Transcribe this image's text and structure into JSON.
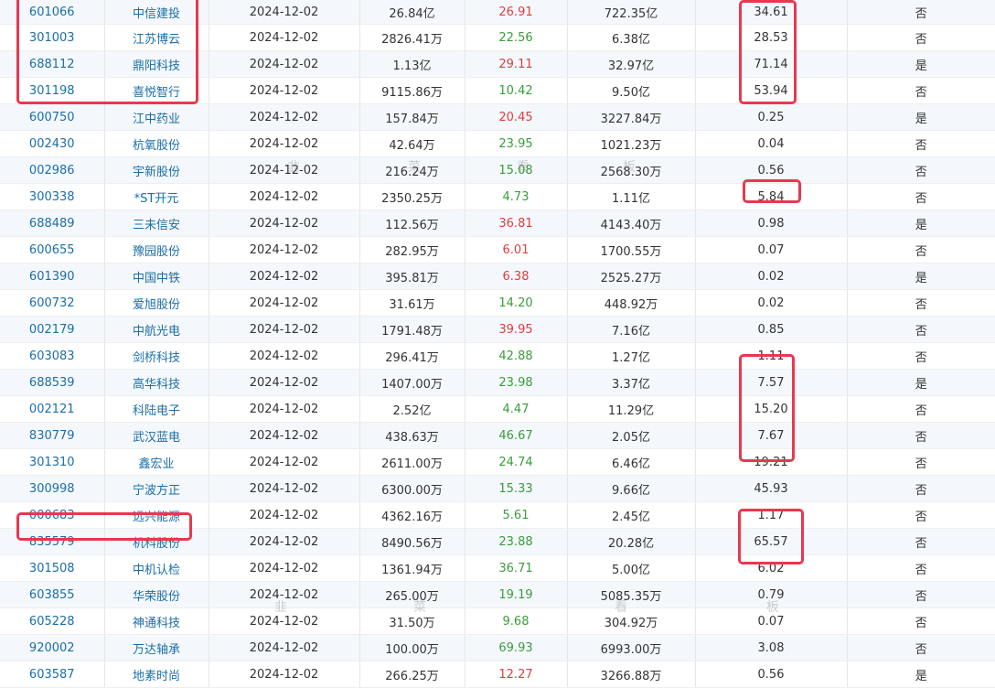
{
  "rows": [
    {
      "code": "601066",
      "name": "中信建投",
      "date": "2024-12-02",
      "turnover": "26.84亿",
      "pct": "26.91",
      "trend": "up",
      "cap": "722.35亿",
      "ratio": "34.61",
      "flag": "否"
    },
    {
      "code": "301003",
      "name": "江苏博云",
      "date": "2024-12-02",
      "turnover": "2826.41万",
      "pct": "22.56",
      "trend": "down",
      "cap": "6.38亿",
      "ratio": "28.53",
      "flag": "否"
    },
    {
      "code": "688112",
      "name": "鼎阳科技",
      "date": "2024-12-02",
      "turnover": "1.13亿",
      "pct": "29.11",
      "trend": "up",
      "cap": "32.97亿",
      "ratio": "71.14",
      "flag": "是"
    },
    {
      "code": "301198",
      "name": "喜悦智行",
      "date": "2024-12-02",
      "turnover": "9115.86万",
      "pct": "10.42",
      "trend": "down",
      "cap": "9.50亿",
      "ratio": "53.94",
      "flag": "否"
    },
    {
      "code": "600750",
      "name": "江中药业",
      "date": "2024-12-02",
      "turnover": "157.84万",
      "pct": "20.45",
      "trend": "up",
      "cap": "3227.84万",
      "ratio": "0.25",
      "flag": "是"
    },
    {
      "code": "002430",
      "name": "杭氧股份",
      "date": "2024-12-02",
      "turnover": "42.64万",
      "pct": "23.95",
      "trend": "down",
      "cap": "1021.23万",
      "ratio": "0.04",
      "flag": "否"
    },
    {
      "code": "002986",
      "name": "宇新股份",
      "date": "2024-12-02",
      "turnover": "216.24万",
      "pct": "15.08",
      "trend": "down",
      "cap": "2568.30万",
      "ratio": "0.56",
      "flag": "否"
    },
    {
      "code": "300338",
      "name": "*ST开元",
      "date": "2024-12-02",
      "turnover": "2350.25万",
      "pct": "4.73",
      "trend": "down",
      "cap": "1.11亿",
      "ratio": "5.84",
      "flag": "否"
    },
    {
      "code": "688489",
      "name": "三未信安",
      "date": "2024-12-02",
      "turnover": "112.56万",
      "pct": "36.81",
      "trend": "up",
      "cap": "4143.40万",
      "ratio": "0.98",
      "flag": "是"
    },
    {
      "code": "600655",
      "name": "豫园股份",
      "date": "2024-12-02",
      "turnover": "282.95万",
      "pct": "6.01",
      "trend": "up",
      "cap": "1700.55万",
      "ratio": "0.07",
      "flag": "否"
    },
    {
      "code": "601390",
      "name": "中国中铁",
      "date": "2024-12-02",
      "turnover": "395.81万",
      "pct": "6.38",
      "trend": "up",
      "cap": "2525.27万",
      "ratio": "0.02",
      "flag": "是"
    },
    {
      "code": "600732",
      "name": "爱旭股份",
      "date": "2024-12-02",
      "turnover": "31.61万",
      "pct": "14.20",
      "trend": "down",
      "cap": "448.92万",
      "ratio": "0.02",
      "flag": "否"
    },
    {
      "code": "002179",
      "name": "中航光电",
      "date": "2024-12-02",
      "turnover": "1791.48万",
      "pct": "39.95",
      "trend": "up",
      "cap": "7.16亿",
      "ratio": "0.85",
      "flag": "否"
    },
    {
      "code": "603083",
      "name": "剑桥科技",
      "date": "2024-12-02",
      "turnover": "296.41万",
      "pct": "42.88",
      "trend": "down",
      "cap": "1.27亿",
      "ratio": "1.11",
      "flag": "否"
    },
    {
      "code": "688539",
      "name": "高华科技",
      "date": "2024-12-02",
      "turnover": "1407.00万",
      "pct": "23.98",
      "trend": "down",
      "cap": "3.37亿",
      "ratio": "7.57",
      "flag": "是"
    },
    {
      "code": "002121",
      "name": "科陆电子",
      "date": "2024-12-02",
      "turnover": "2.52亿",
      "pct": "4.47",
      "trend": "down",
      "cap": "11.29亿",
      "ratio": "15.20",
      "flag": "否"
    },
    {
      "code": "830779",
      "name": "武汉蓝电",
      "date": "2024-12-02",
      "turnover": "438.63万",
      "pct": "46.67",
      "trend": "down",
      "cap": "2.05亿",
      "ratio": "7.67",
      "flag": "否"
    },
    {
      "code": "301310",
      "name": "鑫宏业",
      "date": "2024-12-02",
      "turnover": "2611.00万",
      "pct": "24.74",
      "trend": "down",
      "cap": "6.46亿",
      "ratio": "19.21",
      "flag": "否"
    },
    {
      "code": "300998",
      "name": "宁波方正",
      "date": "2024-12-02",
      "turnover": "6300.00万",
      "pct": "15.33",
      "trend": "down",
      "cap": "9.66亿",
      "ratio": "45.93",
      "flag": "否"
    },
    {
      "code": "000683",
      "name": "远兴能源",
      "date": "2024-12-02",
      "turnover": "4362.16万",
      "pct": "5.61",
      "trend": "down",
      "cap": "2.45亿",
      "ratio": "1.17",
      "flag": "否"
    },
    {
      "code": "835579",
      "name": "机科股份",
      "date": "2024-12-02",
      "turnover": "8490.56万",
      "pct": "23.88",
      "trend": "down",
      "cap": "20.28亿",
      "ratio": "65.57",
      "flag": "否"
    },
    {
      "code": "301508",
      "name": "中机认检",
      "date": "2024-12-02",
      "turnover": "1361.94万",
      "pct": "36.71",
      "trend": "down",
      "cap": "5.00亿",
      "ratio": "6.02",
      "flag": "否"
    },
    {
      "code": "603855",
      "name": "华荣股份",
      "date": "2024-12-02",
      "turnover": "265.00万",
      "pct": "19.19",
      "trend": "down",
      "cap": "5085.35万",
      "ratio": "0.79",
      "flag": "否"
    },
    {
      "code": "605228",
      "name": "神通科技",
      "date": "2024-12-02",
      "turnover": "31.50万",
      "pct": "9.68",
      "trend": "down",
      "cap": "304.92万",
      "ratio": "0.07",
      "flag": "否"
    },
    {
      "code": "920002",
      "name": "万达轴承",
      "date": "2024-12-02",
      "turnover": "100.00万",
      "pct": "69.93",
      "trend": "down",
      "cap": "6993.00万",
      "ratio": "3.08",
      "flag": "否"
    },
    {
      "code": "603587",
      "name": "地素时尚",
      "date": "2024-12-02",
      "turnover": "266.25万",
      "pct": "12.27",
      "trend": "up",
      "cap": "3266.88万",
      "ratio": "0.56",
      "flag": "是"
    }
  ],
  "watermark": [
    "韭",
    "菜",
    "看",
    "板",
    "韭",
    "菜",
    "看",
    "板"
  ],
  "colors": {
    "code_link": "#1a6ea8",
    "up": "#e03c3c",
    "down": "#3a9c3a",
    "highlight": "#e8384f"
  }
}
